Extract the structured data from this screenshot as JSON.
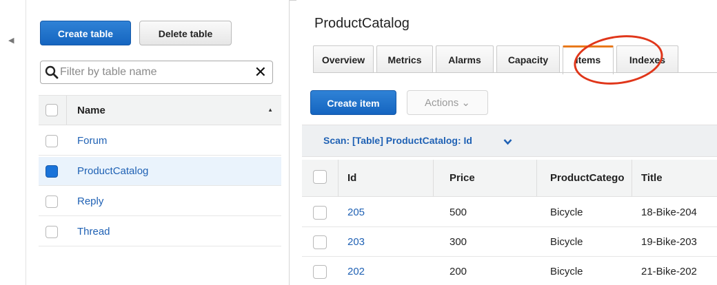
{
  "sidebar": {
    "create_table_label": "Create table",
    "delete_table_label": "Delete table",
    "filter_placeholder": "Filter by table name",
    "clear_symbol": "✕",
    "column_header": "Name",
    "tables": [
      {
        "name": "Forum",
        "selected": false
      },
      {
        "name": "ProductCatalog",
        "selected": true
      },
      {
        "name": "Reply",
        "selected": false
      },
      {
        "name": "Thread",
        "selected": false
      }
    ]
  },
  "main": {
    "title": "ProductCatalog",
    "tabs": [
      {
        "label": "Overview"
      },
      {
        "label": "Metrics"
      },
      {
        "label": "Alarms"
      },
      {
        "label": "Capacity"
      },
      {
        "label": "Items"
      },
      {
        "label": "Indexes"
      }
    ],
    "active_tab": "Items",
    "create_item_label": "Create item",
    "actions_label": "Actions ⌄",
    "scan_label": "Scan: [Table] ProductCatalog: Id",
    "columns": [
      "Id",
      "Price",
      "ProductCatego",
      "Title"
    ],
    "rows": [
      {
        "id": "205",
        "price": "500",
        "category": "Bicycle",
        "title": "18-Bike-204"
      },
      {
        "id": "203",
        "price": "300",
        "category": "Bicycle",
        "title": "19-Bike-203"
      },
      {
        "id": "202",
        "price": "200",
        "category": "Bicycle",
        "title": "21-Bike-202"
      }
    ]
  },
  "colors": {
    "primary_button": "#1565c0",
    "link": "#1f61b4",
    "active_tab_accent": "#e8791b",
    "annotation_oval": "#e0361a"
  }
}
